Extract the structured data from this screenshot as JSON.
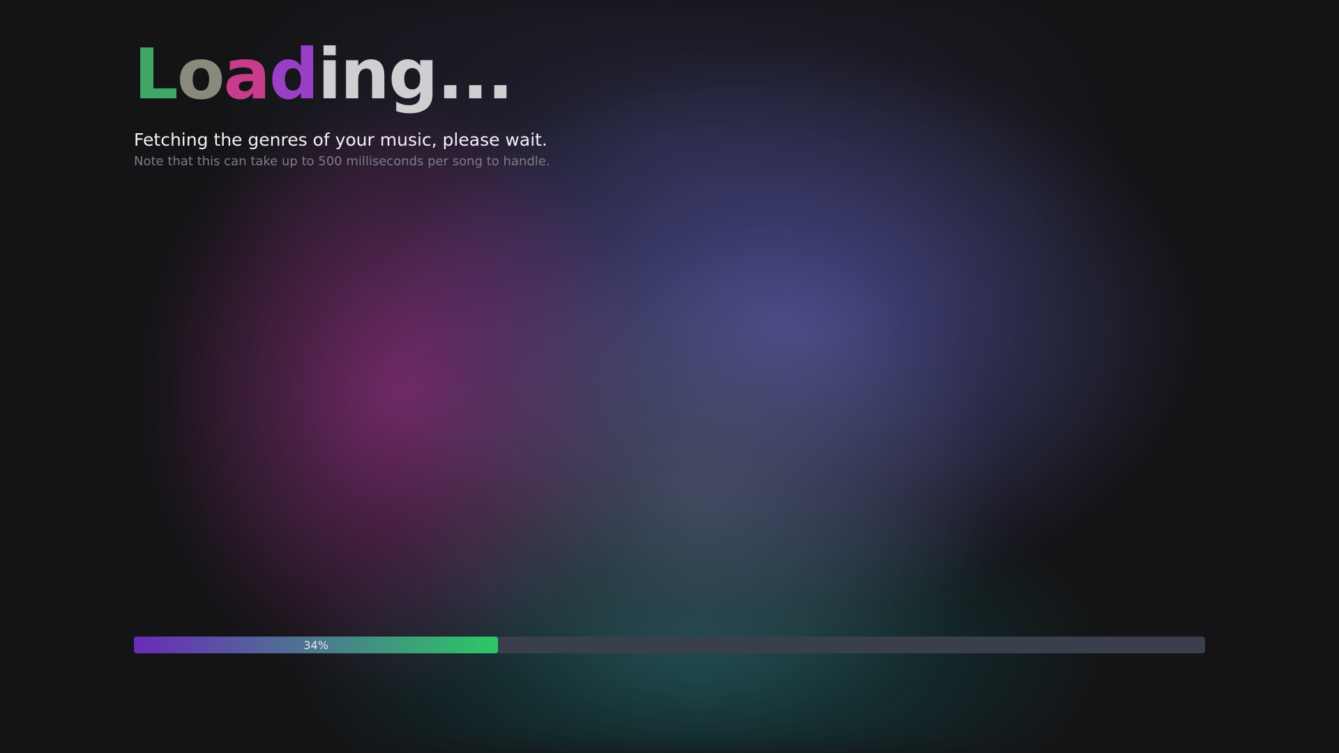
{
  "title": {
    "letters": [
      "L",
      "o",
      "a",
      "d"
    ],
    "rest": "ing..."
  },
  "subtitle": "Fetching the genres of your music, please wait.",
  "note": "Note that this can take up to 500 milliseconds per song to handle.",
  "progress": {
    "value": 0.34,
    "label": "34%",
    "colors": {
      "start": "#6a2bb8",
      "end": "#2cc865",
      "track": "#3a3f4c"
    }
  }
}
